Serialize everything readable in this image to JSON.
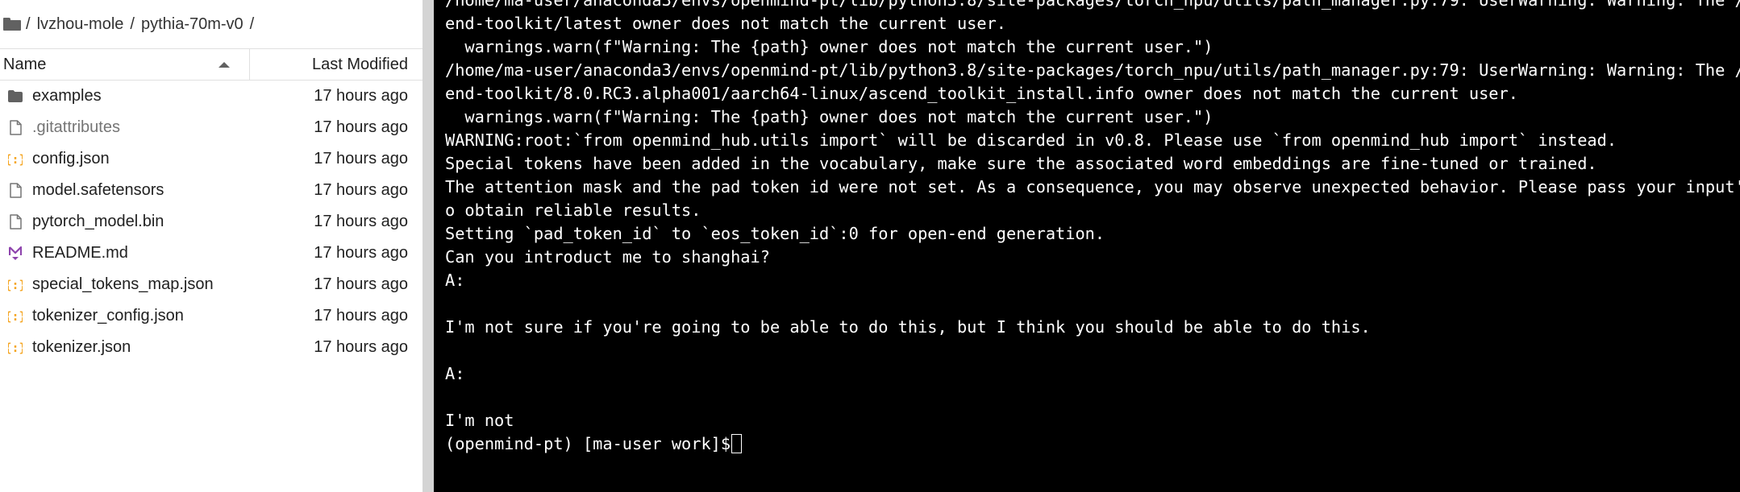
{
  "breadcrumb": {
    "root": "/",
    "segments": [
      "lvzhou-mole",
      "pythia-70m-v0"
    ],
    "trailing": "/"
  },
  "file_list": {
    "columns": {
      "name": "Name",
      "modified": "Last Modified"
    },
    "rows": [
      {
        "name": "examples",
        "modified": "17 hours ago",
        "icon": "folder-icon",
        "dim": false
      },
      {
        "name": ".gitattributes",
        "modified": "17 hours ago",
        "icon": "file-icon",
        "dim": true
      },
      {
        "name": "config.json",
        "modified": "17 hours ago",
        "icon": "json-icon",
        "dim": false
      },
      {
        "name": "model.safetensors",
        "modified": "17 hours ago",
        "icon": "file-icon",
        "dim": false
      },
      {
        "name": "pytorch_model.bin",
        "modified": "17 hours ago",
        "icon": "file-icon",
        "dim": false
      },
      {
        "name": "README.md",
        "modified": "17 hours ago",
        "icon": "markdown-icon",
        "dim": false
      },
      {
        "name": "special_tokens_map.json",
        "modified": "17 hours ago",
        "icon": "json-icon",
        "dim": false
      },
      {
        "name": "tokenizer_config.json",
        "modified": "17 hours ago",
        "icon": "json-icon",
        "dim": false
      },
      {
        "name": "tokenizer.json",
        "modified": "17 hours ago",
        "icon": "json-icon",
        "dim": false
      }
    ]
  },
  "terminal": {
    "lines": [
      "/home/ma-user/anaconda3/envs/openmind-pt/lib/python3.8/site-packages/torch_npu/utils/path_manager.py:79: UserWarning: Warning: The /us",
      "end-toolkit/latest owner does not match the current user.",
      "  warnings.warn(f\"Warning: The {path} owner does not match the current user.\")",
      "/home/ma-user/anaconda3/envs/openmind-pt/lib/python3.8/site-packages/torch_npu/utils/path_manager.py:79: UserWarning: Warning: The /us",
      "end-toolkit/8.0.RC3.alpha001/aarch64-linux/ascend_toolkit_install.info owner does not match the current user.",
      "  warnings.warn(f\"Warning: The {path} owner does not match the current user.\")",
      "WARNING:root:`from openmind_hub.utils import` will be discarded in v0.8. Please use `from openmind_hub import` instead.",
      "Special tokens have been added in the vocabulary, make sure the associated word embeddings are fine-tuned or trained.",
      "The attention mask and the pad token id were not set. As a consequence, you may observe unexpected behavior. Please pass your input's",
      "o obtain reliable results.",
      "Setting `pad_token_id` to `eos_token_id`:0 for open-end generation.",
      "Can you introduct me to shanghai?",
      "A:",
      "",
      "I'm not sure if you're going to be able to do this, but I think you should be able to do this.",
      "",
      "A:",
      "",
      "I'm not"
    ],
    "prompt": "(openmind-pt) [ma-user work]$"
  },
  "colors": {
    "terminal_bg": "#000000",
    "terminal_fg": "#ffffff",
    "json_icon": "#f5a623",
    "markdown_icon": "#8e44ad",
    "splitter": "#d4d4d4"
  }
}
